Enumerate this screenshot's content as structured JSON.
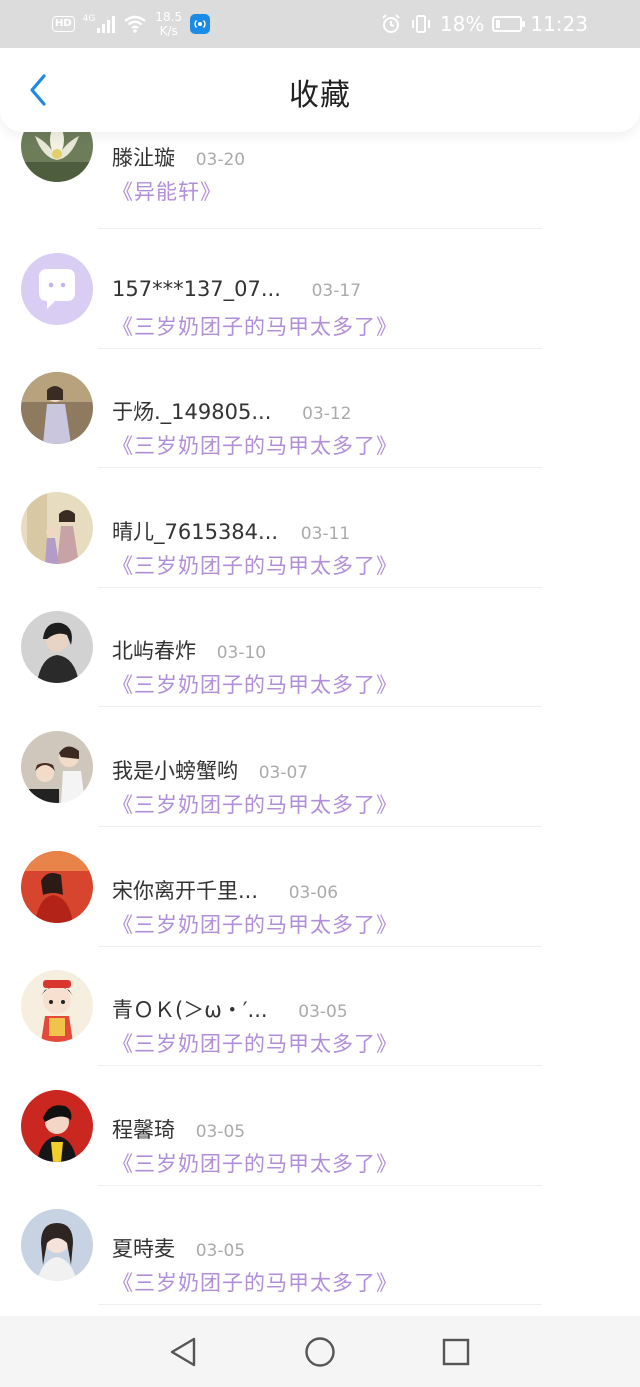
{
  "status_bar": {
    "hd": "HD",
    "net": "4G",
    "speed_top": "18.5",
    "speed_bottom": "K/s",
    "battery": "18%",
    "battery_level": 0.18,
    "time": "11:23"
  },
  "header": {
    "title": "收藏"
  },
  "items": [
    {
      "name": "滕沚璇",
      "date": "03-20",
      "book": "《异能轩》"
    },
    {
      "name": "157***137_07...",
      "date": "03-17",
      "book": "《三岁奶团子的马甲太多了》"
    },
    {
      "name": "于炀._149805...",
      "date": "03-12",
      "book": "《三岁奶团子的马甲太多了》"
    },
    {
      "name": "晴儿_7615384...",
      "date": "03-11",
      "book": "《三岁奶团子的马甲太多了》"
    },
    {
      "name": "北屿春炸",
      "date": "03-10",
      "book": "《三岁奶团子的马甲太多了》"
    },
    {
      "name": "我是小螃蟹哟",
      "date": "03-07",
      "book": "《三岁奶团子的马甲太多了》"
    },
    {
      "name": "宋你离开千里...",
      "date": "03-06",
      "book": "《三岁奶团子的马甲太多了》"
    },
    {
      "name": "青ＯＫ(＞ω・′...",
      "date": "03-05",
      "book": "《三岁奶团子的马甲太多了》"
    },
    {
      "name": "程馨琦",
      "date": "03-05",
      "book": "《三岁奶团子的马甲太多了》"
    },
    {
      "name": "夏時麦",
      "date": "03-05",
      "book": "《三岁奶团子的马甲太多了》"
    }
  ],
  "colors": {
    "accent": "#1e88e5",
    "book_link": "#b08fd8"
  }
}
